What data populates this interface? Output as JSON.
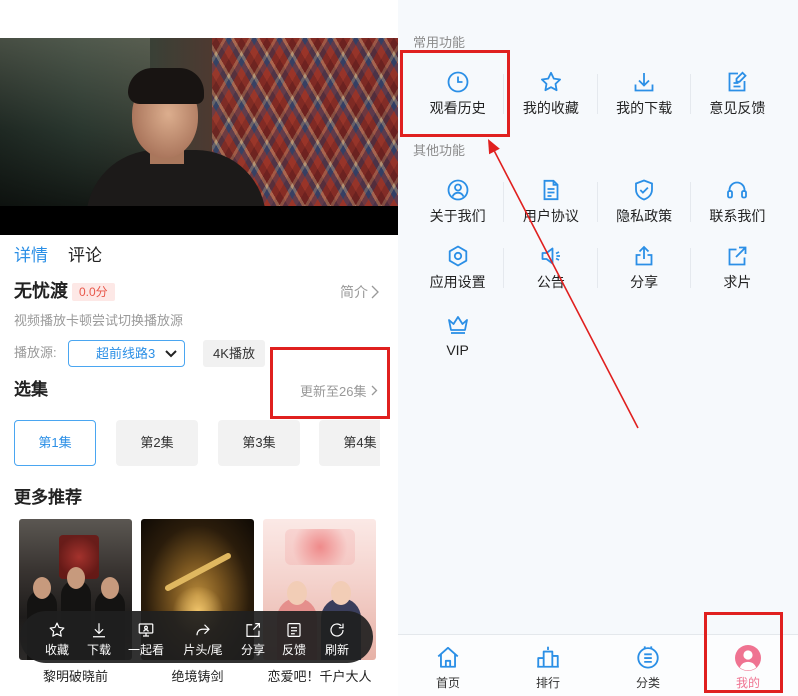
{
  "left_page": {
    "tabs": [
      {
        "label": "详情"
      },
      {
        "label": "评论"
      }
    ],
    "active_tab_index": 0,
    "title": "无忧渡",
    "score": "0.0分",
    "intro_link": "简介",
    "play_hint": "视频播放卡顿尝试切换播放源",
    "source_label": "播放源:",
    "source_selected": "超前线路3",
    "quality_button": "4K播放",
    "episodes_heading": "选集",
    "update_status": "更新至26集",
    "episodes": [
      "第1集",
      "第2集",
      "第3集",
      "第4集"
    ],
    "selected_episode_index": 0,
    "recommend_heading": "更多推荐",
    "recommendations": [
      {
        "title": "黎明破晓前"
      },
      {
        "title": "绝境铸剑"
      },
      {
        "title": "恋爱吧！千户大人"
      }
    ],
    "toolbar": [
      {
        "label": "收藏",
        "icon": "star-icon"
      },
      {
        "label": "下载",
        "icon": "download-icon"
      },
      {
        "label": "一起看",
        "icon": "watch-together-icon"
      },
      {
        "label": "片头/尾",
        "icon": "skip-intro-icon"
      },
      {
        "label": "分享",
        "icon": "share-icon"
      },
      {
        "label": "反馈",
        "icon": "feedback-icon"
      },
      {
        "label": "刷新",
        "icon": "refresh-icon"
      }
    ]
  },
  "right_page": {
    "common_heading": "常用功能",
    "common_functions": [
      {
        "label": "观看历史",
        "icon": "clock-icon"
      },
      {
        "label": "我的收藏",
        "icon": "star-icon"
      },
      {
        "label": "我的下载",
        "icon": "download-icon"
      },
      {
        "label": "意见反馈",
        "icon": "feedback-icon"
      }
    ],
    "other_heading": "其他功能",
    "other_functions": [
      {
        "label": "关于我们",
        "icon": "user-circle-icon"
      },
      {
        "label": "用户协议",
        "icon": "document-icon"
      },
      {
        "label": "隐私政策",
        "icon": "shield-check-icon"
      },
      {
        "label": "联系我们",
        "icon": "headset-icon"
      },
      {
        "label": "应用设置",
        "icon": "settings-icon"
      },
      {
        "label": "公告",
        "icon": "announcement-icon"
      },
      {
        "label": "分享",
        "icon": "share-icon"
      },
      {
        "label": "求片",
        "icon": "request-icon"
      },
      {
        "label": "VIP",
        "icon": "crown-icon"
      }
    ],
    "tab_bar": [
      {
        "label": "首页",
        "icon": "home-icon"
      },
      {
        "label": "排行",
        "icon": "ranking-icon"
      },
      {
        "label": "分类",
        "icon": "category-icon"
      },
      {
        "label": "我的",
        "icon": "avatar-icon"
      }
    ],
    "active_tab_index": 3
  },
  "colors": {
    "accent": "#2b8fe6",
    "annotation": "#e0201f",
    "score": "#e8574a",
    "active_profile": "#ef7391"
  }
}
